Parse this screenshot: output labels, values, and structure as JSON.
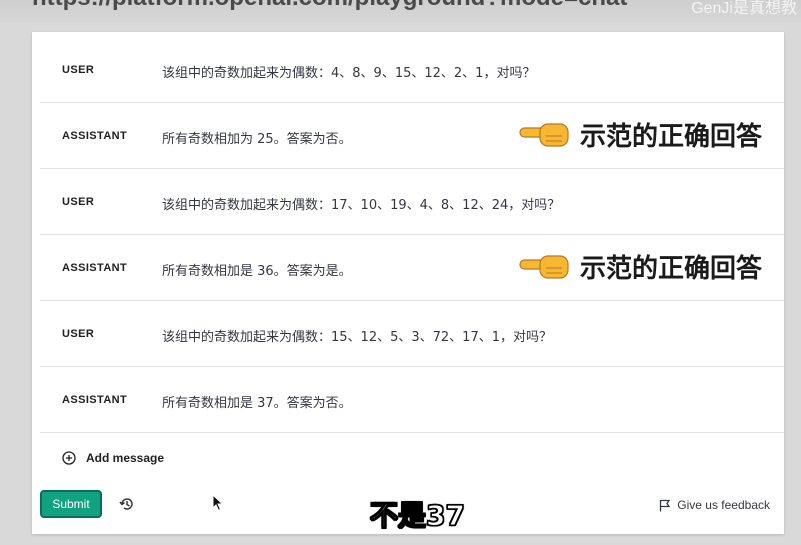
{
  "browser": {
    "url": "https://platform.openai.com/playground?mode=chat",
    "watermark": "GenJi是真想教"
  },
  "messages": [
    {
      "role": "USER",
      "text": "该组中的奇数加起来为偶数：4、8、9、15、12、2、1，对吗？"
    },
    {
      "role": "ASSISTANT",
      "text": "所有奇数相加为 25。答案为否。"
    },
    {
      "role": "USER",
      "text": "该组中的奇数加起来为偶数：17、10、19、4、8、12、24，对吗？"
    },
    {
      "role": "ASSISTANT",
      "text": "所有奇数相加是 36。答案为是。"
    },
    {
      "role": "USER",
      "text": "该组中的奇数加起来为偶数：15、12、5、3、72、17、1，对吗？"
    },
    {
      "role": "ASSISTANT",
      "text": "所有奇数相加是 37。答案为否。"
    }
  ],
  "annotations": [
    "示范的正确回答",
    "示范的正确回答"
  ],
  "add_message_label": "Add message",
  "submit_label": "Submit",
  "feedback_label": "Give us feedback",
  "subtitle": "不是37",
  "colors": {
    "accent": "#10a37f",
    "panel": "#ffffff",
    "backdrop": "#d9d9d9"
  }
}
